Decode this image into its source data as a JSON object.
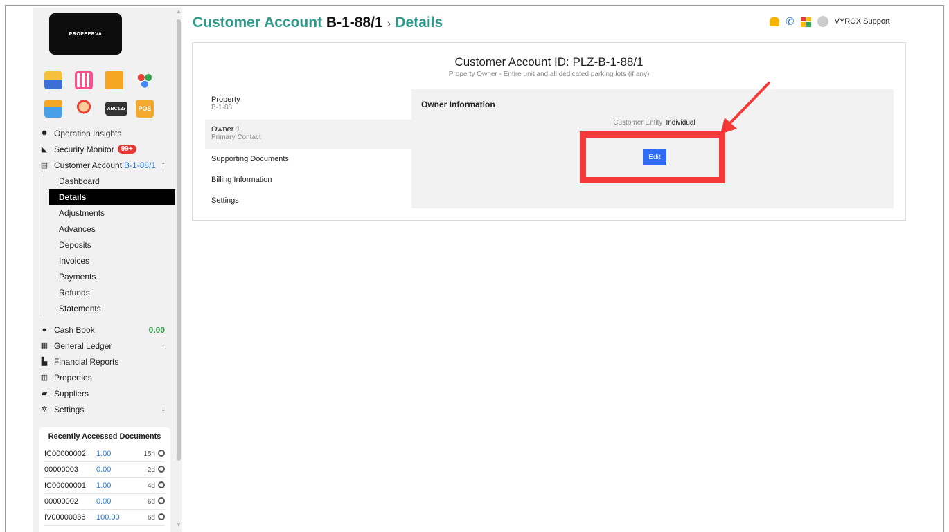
{
  "logo": {
    "text": "PROPEERVA"
  },
  "header": {
    "title_prefix": "Customer Account",
    "title_account": "B-1-88/1",
    "separator": "›",
    "title_page": "Details",
    "user_name": "VYROX Support"
  },
  "app_icons": [
    "id-card-icon",
    "calendar-icon",
    "bank-icon",
    "apps-icon",
    "key-card-icon",
    "face-id-icon",
    "abc123-icon",
    "pos-icon"
  ],
  "app_icon_texts": {
    "abc": "ABC123",
    "pos": "POS"
  },
  "sidebar": {
    "operation_insights": "Operation Insights",
    "security_monitor": "Security Monitor",
    "security_badge": "99+",
    "customer_account": "Customer Account",
    "customer_account_id": "B-1-88/1",
    "sub_items": [
      "Dashboard",
      "Details",
      "Adjustments",
      "Advances",
      "Deposits",
      "Invoices",
      "Payments",
      "Refunds",
      "Statements"
    ],
    "cash_book": "Cash Book",
    "cash_book_value": "0.00",
    "general_ledger": "General Ledger",
    "financial_reports": "Financial Reports",
    "properties": "Properties",
    "suppliers": "Suppliers",
    "settings": "Settings",
    "arrow_up": "↑",
    "arrow_down": "↓"
  },
  "recent": {
    "title": "Recently Accessed Documents",
    "rows": [
      {
        "doc": "IC00000002",
        "amount": "1.00",
        "age": "15h"
      },
      {
        "doc": "00000003",
        "amount": "0.00",
        "age": "2d"
      },
      {
        "doc": "IC00000001",
        "amount": "1.00",
        "age": "4d"
      },
      {
        "doc": "00000002",
        "amount": "0.00",
        "age": "6d"
      },
      {
        "doc": "IV00000036",
        "amount": "100.00",
        "age": "6d"
      }
    ]
  },
  "card": {
    "title": "Customer Account ID: PLZ-B-1-88/1",
    "subtitle": "Property Owner - Entire unit and all dedicated parking lots (if any)",
    "tabs": [
      {
        "label": "Property",
        "sub": "B-1-88"
      },
      {
        "label": "Owner 1",
        "sub": "Primary Contact"
      },
      {
        "label": "Supporting Documents"
      },
      {
        "label": "Billing Information"
      },
      {
        "label": "Settings"
      }
    ],
    "panel_title": "Owner Information",
    "entity_label": "Customer Entity",
    "entity_value": "Individual",
    "edit_label": "Edit"
  },
  "colors": {
    "accent_teal": "#2e9c8c",
    "primary_blue": "#2f6bf5",
    "highlight_red": "#f53838",
    "badge_red": "#e53935",
    "cash_green": "#2f9e44"
  }
}
